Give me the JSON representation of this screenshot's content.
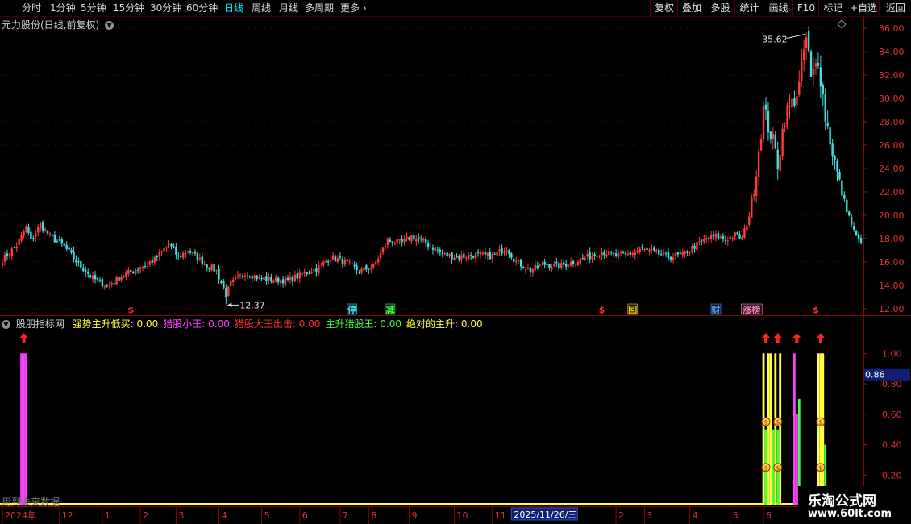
{
  "toolbar": {
    "periods": [
      "分时",
      "1分钟",
      "5分钟",
      "15分钟",
      "30分钟",
      "60分钟",
      "日线",
      "周线",
      "月线",
      "多周期",
      "更多"
    ],
    "active_period": "日线",
    "more_icon": "chevron-right-icon",
    "right_buttons": [
      "复权",
      "叠加",
      "多股",
      "统计",
      "画线",
      "F10",
      "标记",
      "+自选",
      "返回"
    ]
  },
  "main_panel": {
    "title": "元力股份(日线,前复权)",
    "title_icon": "chevron-down-circle-icon",
    "corner_icon": "diamond-icon",
    "high_label": "35.62",
    "low_label": "12.37",
    "event_markers": [
      {
        "label": "$",
        "color": "#ff3030",
        "idx": 54
      },
      {
        "label": "停",
        "color": "#40e0ff",
        "idx": 147
      },
      {
        "label": "减",
        "color": "#40ff40",
        "idx": 163
      },
      {
        "label": "$",
        "color": "#ff3030",
        "idx": 252
      },
      {
        "label": "回",
        "color": "#ffcc00",
        "idx": 265
      },
      {
        "label": "财",
        "color": "#40a0ff",
        "idx": 300
      },
      {
        "label": "涨榜",
        "color": "#ff80c0",
        "idx": 315
      },
      {
        "label": "$",
        "color": "#ff3030",
        "idx": 342
      }
    ]
  },
  "indicator_panel": {
    "name": "股朋指标网",
    "name_icon": "chevron-down-circle-icon",
    "items": [
      {
        "label": "强势主升低买:",
        "value": "0.00",
        "color": "#ffff40"
      },
      {
        "label": "猎股小王:",
        "value": "0.00",
        "color": "#ff40ff"
      },
      {
        "label": "猎股大王出击:",
        "value": "0.00",
        "color": "#ff3030"
      },
      {
        "label": "主升猎股王:",
        "value": "0.00",
        "color": "#40ff40"
      },
      {
        "label": "绝对的主升:",
        "value": "0.00",
        "color": "#ffff40"
      }
    ],
    "current_value": "0.86",
    "future_data_note": "用到未来数据"
  },
  "x_axis": {
    "labels": [
      {
        "text": "2024年",
        "idx": 0
      },
      {
        "text": "12",
        "idx": 24
      },
      {
        "text": "1",
        "idx": 42
      },
      {
        "text": "2",
        "idx": 58
      },
      {
        "text": "3",
        "idx": 73
      },
      {
        "text": "4",
        "idx": 91
      },
      {
        "text": "5",
        "idx": 109
      },
      {
        "text": "6",
        "idx": 125
      },
      {
        "text": "7",
        "idx": 142
      },
      {
        "text": "8",
        "idx": 154
      },
      {
        "text": "9",
        "idx": 171
      },
      {
        "text": "10",
        "idx": 190
      },
      {
        "text": "11",
        "idx": 206
      },
      {
        "text": "2",
        "idx": 258
      },
      {
        "text": "3",
        "idx": 270
      },
      {
        "text": "4",
        "idx": 289
      },
      {
        "text": "5",
        "idx": 306
      },
      {
        "text": "6",
        "idx": 320
      }
    ],
    "cursor_date": "2025/11/26/三"
  },
  "watermark": {
    "line1": "乐淘公式网",
    "line2": "www.60lt.com"
  },
  "chart_data": [
    {
      "type": "candlestick",
      "title": "元力股份(日线,前复权)",
      "y_ticks": [
        "12.00",
        "14.00",
        "16.00",
        "18.00",
        "20.00",
        "22.00",
        "24.00",
        "26.00",
        "28.00",
        "30.00",
        "32.00",
        "34.00",
        "36.00"
      ],
      "ylim": [
        11.5,
        36.9
      ],
      "high": 35.62,
      "low": 12.37,
      "keypoints": [
        [
          0,
          16.2
        ],
        [
          6,
          17.4
        ],
        [
          10,
          19.0
        ],
        [
          12,
          17.8
        ],
        [
          16,
          19.2
        ],
        [
          20,
          18.2
        ],
        [
          26,
          17.3
        ],
        [
          32,
          15.8
        ],
        [
          38,
          14.6
        ],
        [
          44,
          13.9
        ],
        [
          50,
          14.8
        ],
        [
          58,
          15.5
        ],
        [
          64,
          16.2
        ],
        [
          70,
          17.5
        ],
        [
          74,
          16.4
        ],
        [
          78,
          17.0
        ],
        [
          84,
          16.0
        ],
        [
          90,
          15.2
        ],
        [
          94,
          13.2
        ],
        [
          96,
          14.1
        ],
        [
          102,
          15.1
        ],
        [
          108,
          14.6
        ],
        [
          114,
          14.5
        ],
        [
          120,
          14.4
        ],
        [
          126,
          14.9
        ],
        [
          132,
          15.4
        ],
        [
          138,
          16.4
        ],
        [
          144,
          16.0
        ],
        [
          150,
          15.2
        ],
        [
          156,
          15.6
        ],
        [
          162,
          17.8
        ],
        [
          168,
          17.6
        ],
        [
          172,
          18.2
        ],
        [
          178,
          17.6
        ],
        [
          186,
          16.6
        ],
        [
          192,
          16.4
        ],
        [
          198,
          16.6
        ],
        [
          206,
          16.5
        ],
        [
          212,
          17.2
        ],
        [
          216,
          16.0
        ],
        [
          222,
          15.3
        ],
        [
          228,
          15.8
        ],
        [
          234,
          15.6
        ],
        [
          240,
          16.0
        ],
        [
          246,
          16.4
        ],
        [
          252,
          16.9
        ],
        [
          258,
          16.5
        ],
        [
          264,
          16.7
        ],
        [
          268,
          17.1
        ],
        [
          274,
          16.8
        ],
        [
          280,
          16.4
        ],
        [
          286,
          16.6
        ],
        [
          290,
          17.2
        ],
        [
          296,
          18.0
        ],
        [
          300,
          18.2
        ],
        [
          304,
          17.9
        ],
        [
          308,
          18.3
        ],
        [
          311,
          18.0
        ],
        [
          314,
          20.0
        ],
        [
          317,
          24.0
        ],
        [
          320,
          29.0
        ],
        [
          323,
          27.0
        ],
        [
          326,
          24.5
        ],
        [
          329,
          28.5
        ],
        [
          332,
          29.5
        ],
        [
          335,
          31.0
        ],
        [
          338,
          35.62
        ],
        [
          340,
          31.5
        ],
        [
          343,
          33.5
        ],
        [
          346,
          28.5
        ],
        [
          349,
          25.5
        ],
        [
          352,
          22.5
        ],
        [
          355,
          20.5
        ],
        [
          358,
          18.6
        ],
        [
          360,
          17.8
        ]
      ]
    },
    {
      "type": "bar",
      "title": "股朋指标网",
      "y_ticks": [
        "0.20",
        "0.40",
        "0.60",
        "0.80",
        "1.00"
      ],
      "ylim": [
        0,
        1.15
      ],
      "series": [
        {
          "name": "强势主升低买",
          "color": "#ffff40",
          "bars": [
            [
              320,
              1.0
            ],
            [
              322,
              1.0
            ],
            [
              323,
              1.0
            ],
            [
              325,
              1.0
            ],
            [
              327,
              1.0
            ],
            [
              343,
              1.0
            ],
            [
              344,
              1.0
            ],
            [
              345,
              1.0
            ]
          ]
        },
        {
          "name": "猎股小王",
          "color": "#ff40ff",
          "bars": [
            [
              8,
              1.0
            ],
            [
              9,
              1.0
            ],
            [
              10,
              1.0
            ],
            [
              333,
              1.0
            ],
            [
              334,
              0.6
            ]
          ]
        },
        {
          "name": "主升猎股王",
          "color": "#40ff40",
          "bars": [
            [
              321,
              0.5
            ],
            [
              324,
              0.5
            ],
            [
              326,
              0.5
            ],
            [
              335,
              0.7
            ],
            [
              346,
              0.4
            ]
          ]
        }
      ],
      "up_arrows": [
        9,
        321,
        326,
        334,
        344
      ],
      "coin_markers": [
        [
          321,
          0.55
        ],
        [
          326,
          0.55
        ],
        [
          344,
          0.55
        ],
        [
          321,
          0.25
        ],
        [
          326,
          0.25
        ],
        [
          344,
          0.25
        ]
      ]
    }
  ]
}
